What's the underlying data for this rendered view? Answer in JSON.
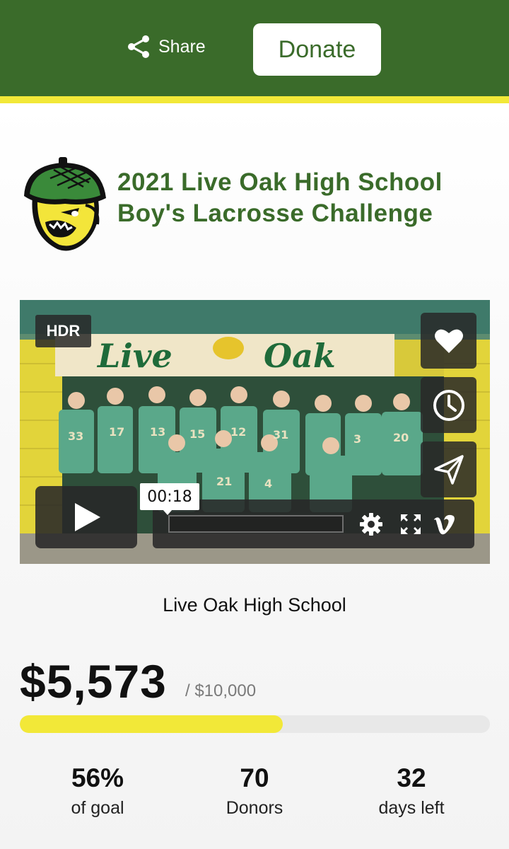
{
  "header": {
    "share_label": "Share",
    "donate_label": "Donate",
    "bar_color": "#3a6b2a",
    "stripe_color": "#f2e838"
  },
  "campaign": {
    "title_line1": "2021 Live Oak High School",
    "title_line2": "Boy's Lacrosse Challenge",
    "organization": "Live Oak High School"
  },
  "video": {
    "hdr_badge": "HDR",
    "current_time": "00:18",
    "progress": 0.0,
    "banner_text_left": "Live",
    "banner_text_right": "Oak",
    "side_icons": [
      "heart-icon",
      "clock-icon",
      "send-icon"
    ],
    "control_icons": [
      "play-icon",
      "settings-gear-icon",
      "fullscreen-icon",
      "vimeo-logo-icon"
    ]
  },
  "fundraising": {
    "raised": "$5,573",
    "goal": "/ $10,000",
    "progress_fraction": 0.56,
    "stats": [
      {
        "value": "56%",
        "label": "of goal"
      },
      {
        "value": "70",
        "label": "Donors"
      },
      {
        "value": "32",
        "label": "days left"
      }
    ]
  }
}
